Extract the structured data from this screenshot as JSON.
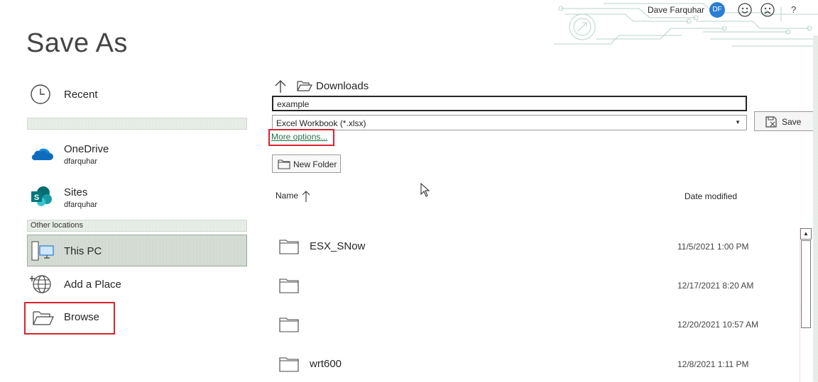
{
  "header": {
    "user_name": "Dave Farquhar",
    "avatar_initials": "DF",
    "help_label": "?",
    "accent_color": "#2b7cd3"
  },
  "page_title": "Save As",
  "nav": {
    "recent": {
      "label": "Recent",
      "icon": "clock-icon"
    },
    "onedrive": {
      "label": "OneDrive",
      "sub": "dfarquhar",
      "icon": "onedrive-icon"
    },
    "sites": {
      "label": "Sites",
      "sub": "dfarquhar",
      "icon": "sharepoint-icon"
    },
    "section_label": "Other locations",
    "thispc": {
      "label": "This PC",
      "icon": "computer-icon"
    },
    "add_place": {
      "label": "Add a Place",
      "icon": "globe-icon"
    },
    "browse": {
      "label": "Browse",
      "icon": "folder-open-icon"
    }
  },
  "location": {
    "folder": "Downloads"
  },
  "form": {
    "filename": "example",
    "filetype": "Excel Workbook (*.xlsx)",
    "save_label": "Save",
    "more_options": "More options...",
    "new_folder": "New Folder"
  },
  "file_list": {
    "col_name": "Name",
    "col_date": "Date modified",
    "rows": [
      {
        "name": "ESX_SNow",
        "date": "11/5/2021 1:00 PM"
      },
      {
        "name": "",
        "date": "12/17/2021 8:20 AM"
      },
      {
        "name": "",
        "date": "12/20/2021 10:57 AM"
      },
      {
        "name": "wrt600",
        "date": "12/8/2021 1:11 PM"
      }
    ]
  },
  "highlight_color": "#d9232e",
  "link_color": "#217346"
}
